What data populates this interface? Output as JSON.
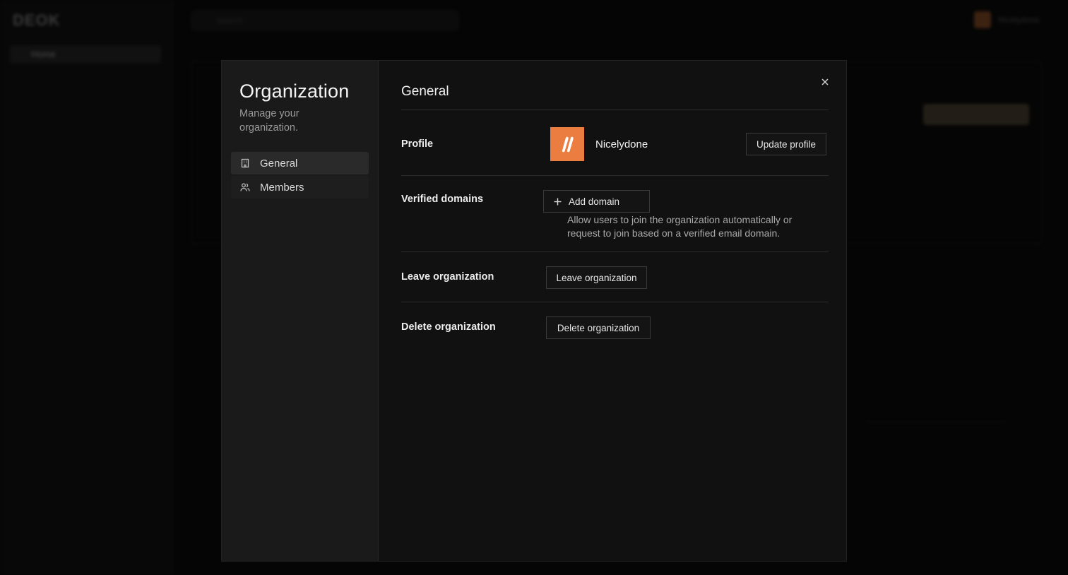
{
  "background": {
    "logo": "DEOK",
    "nav_home": "Home",
    "search_placeholder": "Search",
    "user_name": "Nicelydone"
  },
  "modal": {
    "title": "Organization",
    "subtitle": "Manage your organization.",
    "nav": [
      {
        "label": "General",
        "icon": "building-icon",
        "active": true
      },
      {
        "label": "Members",
        "icon": "users-icon",
        "active": false
      }
    ],
    "section_title": "General",
    "close_icon": "close-icon",
    "profile": {
      "label": "Profile",
      "org_name": "Nicelydone",
      "button": "Update profile",
      "logo_color": "#ea7d3f"
    },
    "domains": {
      "label": "Verified domains",
      "button": "Add domain",
      "help": "Allow users to join the organization automatically or request to join based on a verified email domain."
    },
    "leave": {
      "label": "Leave organization",
      "button": "Leave organization"
    },
    "delete": {
      "label": "Delete organization",
      "button": "Delete organization"
    }
  }
}
